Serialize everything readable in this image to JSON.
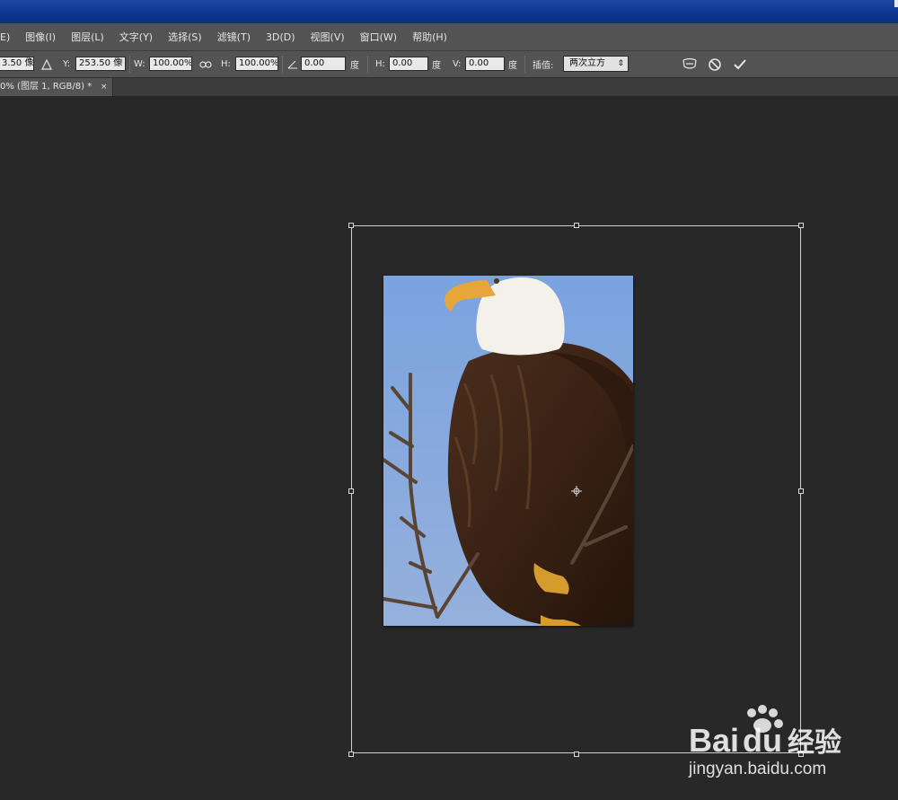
{
  "menu": {
    "items": [
      "E)",
      "图像(I)",
      "图层(L)",
      "文字(Y)",
      "选择(S)",
      "滤镜(T)",
      "3D(D)",
      "视图(V)",
      "窗口(W)",
      "帮助(H)"
    ]
  },
  "options": {
    "x_value": "3.50 像",
    "y_label": "Y:",
    "y_value": "253.50 像",
    "w_label": "W:",
    "w_value": "100.00%",
    "h_label": "H:",
    "h_value": "100.00%",
    "angle_value": "0.00",
    "deg1": "度",
    "hskew_label": "H:",
    "hskew_value": "0.00",
    "deg2": "度",
    "vskew_label": "V:",
    "vskew_value": "0.00",
    "deg3": "度",
    "interp_label": "插值:",
    "interp_value": "两次立方"
  },
  "tab": {
    "title": "0% (图层 1, RGB/8) *",
    "close": "×"
  },
  "watermark": {
    "brand": "Bai",
    "brand2": "du",
    "cn": "经验",
    "url": "jingyan.baidu.com"
  },
  "colors": {
    "titlebar": "#0d3590",
    "ui_panel": "#535353",
    "canvas": "#282828",
    "sky": "#7fa4dc"
  }
}
